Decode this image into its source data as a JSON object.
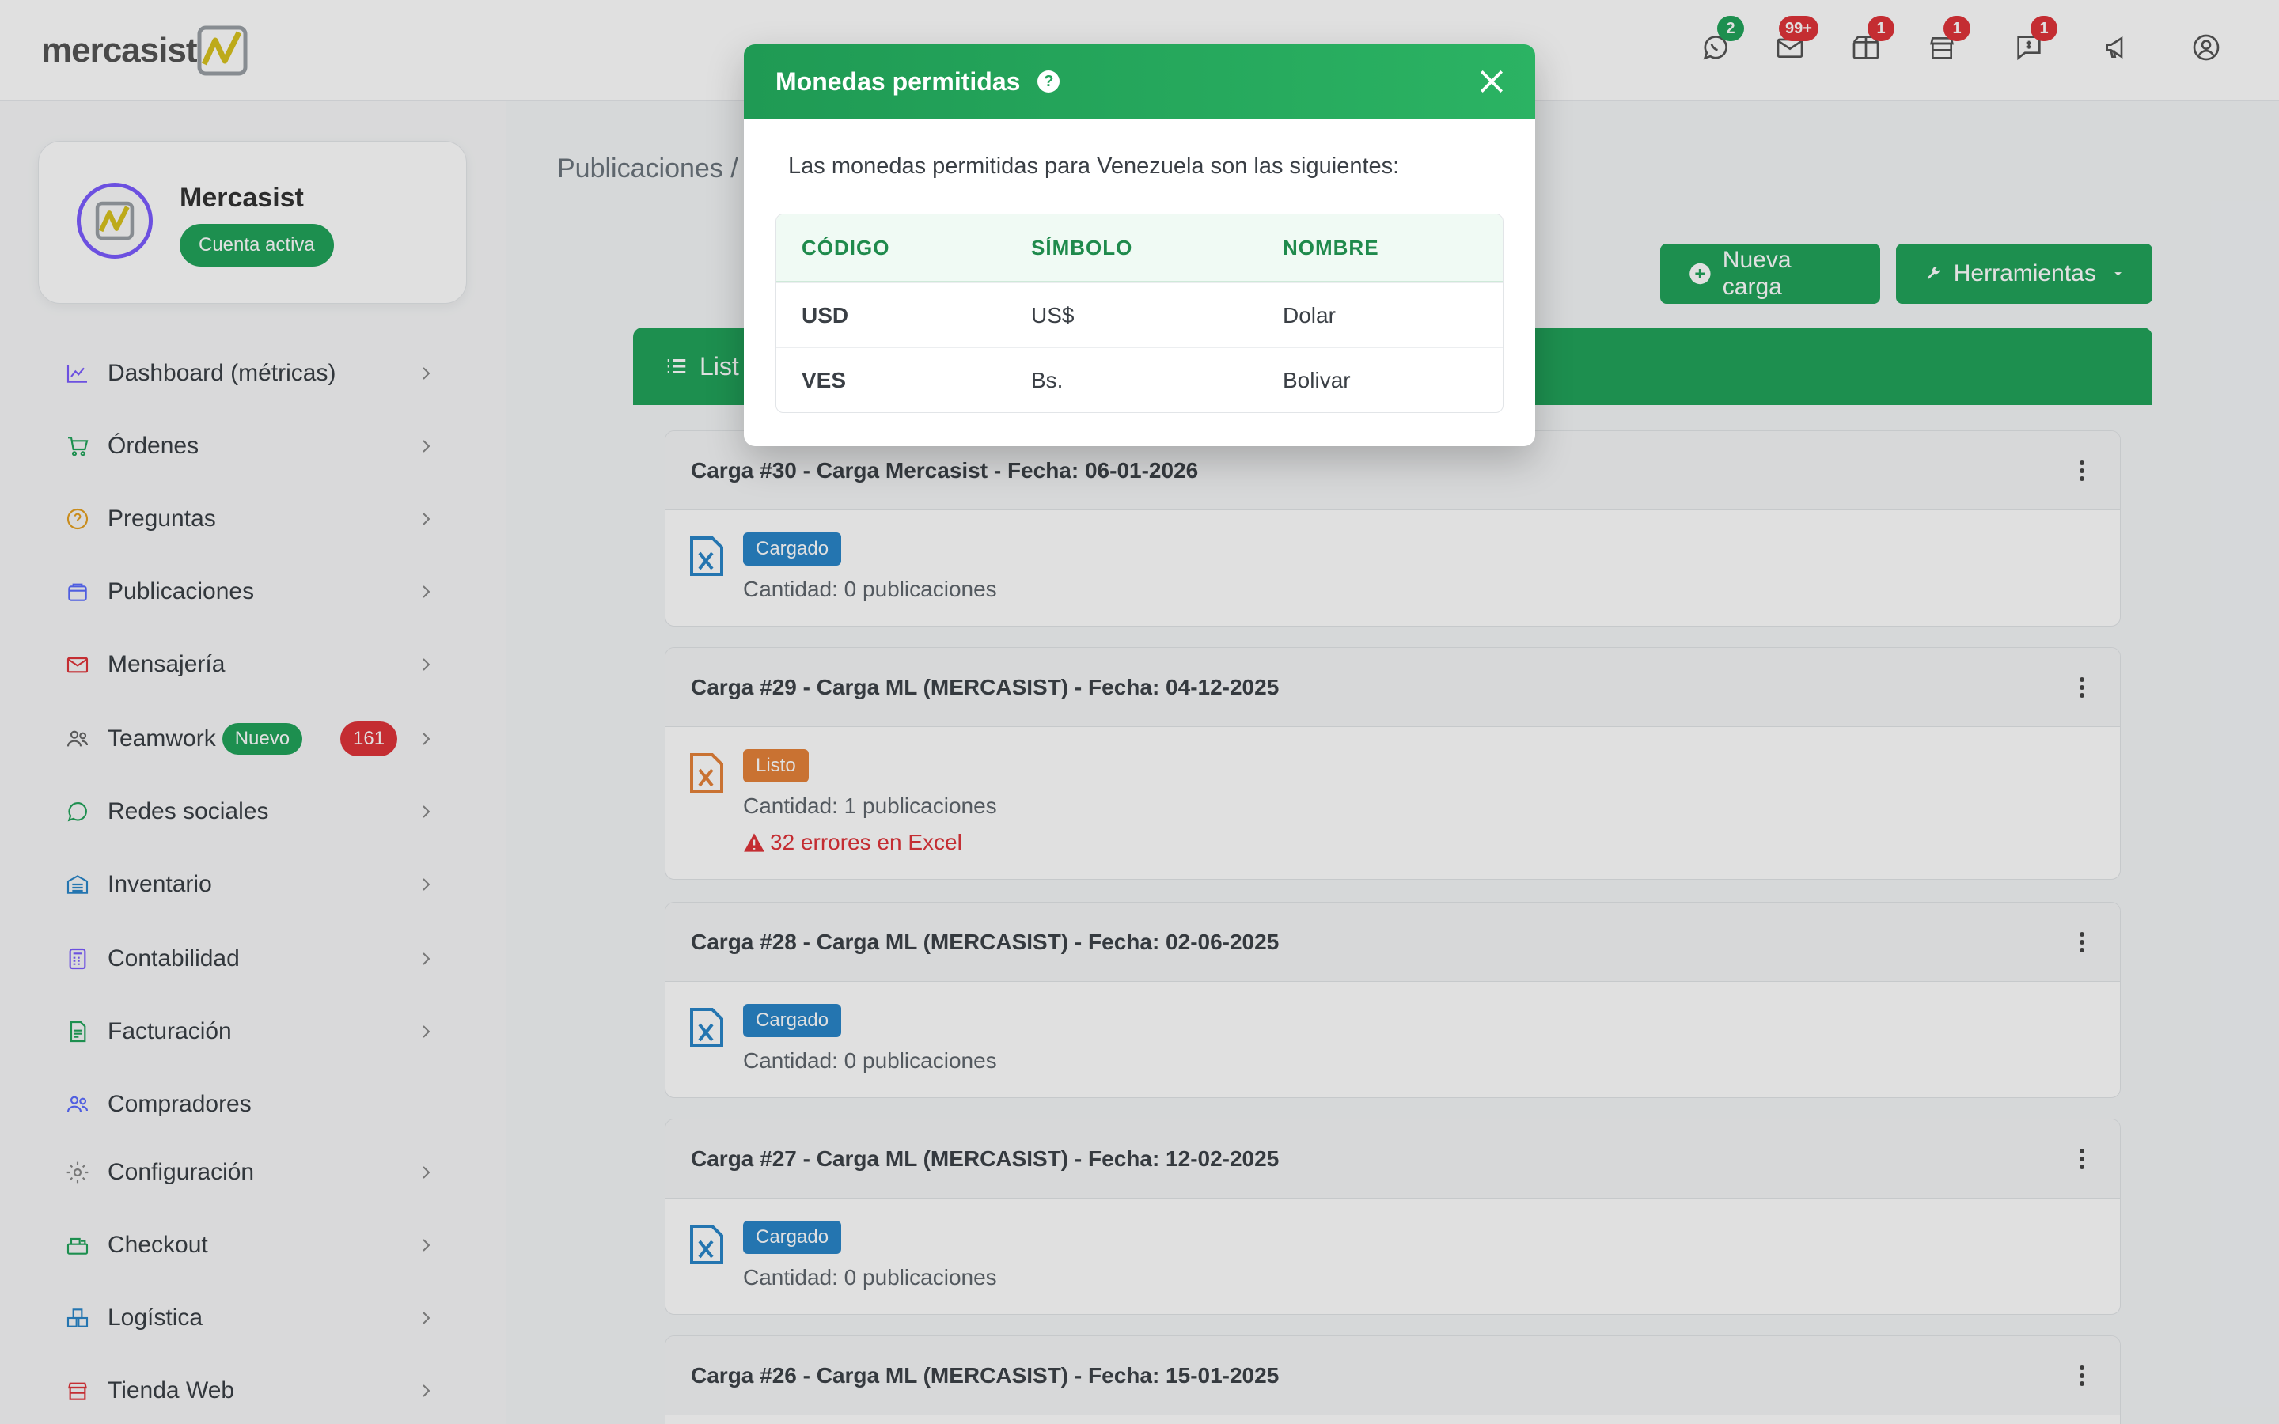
{
  "app": {
    "logo_text": "mercasist"
  },
  "colors": {
    "primary": "#22a35a",
    "danger": "#e0343a",
    "info": "#2a86c9",
    "warning": "#e5823a",
    "accent_purple": "#7b5cff"
  },
  "topbar": {
    "icons": [
      {
        "name": "whatsapp-icon",
        "badge": "2",
        "badge_color": "#22a35a"
      },
      {
        "name": "mail-icon",
        "badge": "99+",
        "badge_color": "#e0343a"
      },
      {
        "name": "package-icon",
        "badge": "1",
        "badge_color": "#e0343a"
      },
      {
        "name": "store-icon",
        "badge": "1",
        "badge_color": "#e0343a"
      },
      {
        "name": "billing-chat-icon",
        "badge": "1",
        "badge_color": "#e0343a"
      },
      {
        "name": "megaphone-icon",
        "badge": ""
      },
      {
        "name": "user-circle-icon",
        "badge": ""
      }
    ]
  },
  "profile": {
    "name": "Mercasist",
    "status": "Cuenta activa"
  },
  "sidebar": {
    "items": [
      {
        "label": "Dashboard (métricas)",
        "icon": "chart-line-icon"
      },
      {
        "label": "Órdenes",
        "icon": "cart-icon"
      },
      {
        "label": "Preguntas",
        "icon": "question-circle-icon"
      },
      {
        "label": "Publicaciones",
        "icon": "bag-icon"
      },
      {
        "label": "Mensajería",
        "icon": "envelope-icon"
      },
      {
        "label": "Teamwork",
        "icon": "users-icon",
        "badge": "Nuevo",
        "count": "161"
      },
      {
        "label": "Redes sociales",
        "icon": "whatsapp-icon"
      },
      {
        "label": "Inventario",
        "icon": "warehouse-icon"
      },
      {
        "label": "Contabilidad",
        "icon": "calculator-icon"
      },
      {
        "label": "Facturación",
        "icon": "invoice-icon"
      },
      {
        "label": "Compradores",
        "icon": "buyers-icon"
      },
      {
        "label": "Configuración",
        "icon": "gear-icon"
      },
      {
        "label": "Checkout",
        "icon": "register-icon"
      },
      {
        "label": "Logística",
        "icon": "boxes-icon"
      },
      {
        "label": "Tienda Web",
        "icon": "store-icon"
      }
    ]
  },
  "main": {
    "breadcrumb": "Publicaciones /",
    "buttons": {
      "new_load": "Nueva carga",
      "tools": "Herramientas"
    },
    "list_header": "List",
    "loads": [
      {
        "title": "Carga #30 - Carga Mercasist - Fecha: 06-01-2026",
        "status": "Cargado",
        "status_color": "#2a86c9",
        "quantity": "Cantidad: 0 publicaciones",
        "errors": ""
      },
      {
        "title": "Carga #29 - Carga ML (MERCASIST) - Fecha: 04-12-2025",
        "status": "Listo",
        "status_color": "#e5823a",
        "quantity": "Cantidad: 1 publicaciones",
        "errors": "32 errores en Excel"
      },
      {
        "title": "Carga #28 - Carga ML (MERCASIST) - Fecha: 02-06-2025",
        "status": "Cargado",
        "status_color": "#2a86c9",
        "quantity": "Cantidad: 0 publicaciones",
        "errors": ""
      },
      {
        "title": "Carga #27 - Carga ML (MERCASIST) - Fecha: 12-02-2025",
        "status": "Cargado",
        "status_color": "#2a86c9",
        "quantity": "Cantidad: 0 publicaciones",
        "errors": ""
      },
      {
        "title": "Carga #26 - Carga ML (MERCASIST) - Fecha: 15-01-2025",
        "status": "",
        "status_color": "#2a86c9",
        "quantity": "",
        "errors": ""
      }
    ]
  },
  "modal": {
    "title": "Monedas permitidas",
    "description": "Las monedas permitidas para Venezuela son las siguientes:",
    "columns": [
      "CÓDIGO",
      "SÍMBOLO",
      "NOMBRE"
    ],
    "rows": [
      {
        "code": "USD",
        "symbol": "US$",
        "name": "Dolar"
      },
      {
        "code": "VES",
        "symbol": "Bs.",
        "name": "Bolivar"
      }
    ]
  }
}
